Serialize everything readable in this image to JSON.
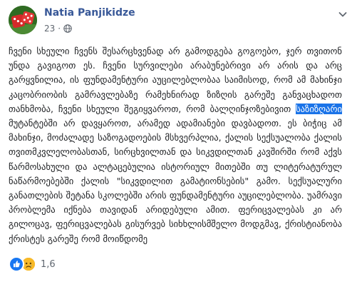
{
  "post": {
    "author": "Natia Panjikidze",
    "timestamp": "23",
    "separator": "·",
    "privacy_icon": "globe-icon",
    "menu_icon": "chevron-down-icon",
    "text_before": "ჩვენი სხეული ჩვენს შესარცხვენად არ გამოდგება გოგოებო, ჯერ თვითონ უნდა გავიგოთ ეს. ჩვენი სურვილები არაბუნებრივი არ არის და არც გარყვნილია, ის ფუნდამენტური აუცილებლობაა საიმისოდ, რომ ამ მახინჯი კაცობრიობის გამრავლებაზე რამეხნირად ზიზღის გარეშე განვაცხადოთ თანხმობა, ჩვენი სხეული შეგიყვაროთ, რომ ბალღინჯოზებივით ",
    "highlighted_text": "საზიზღარი",
    "text_after": " მუტანტებში არ დავყაროთ, არამედ ადამიანები დავბადოთ. ეს ბიჭიც ამ მახინჯი, მოძალადე საზოგადოების მსხვერპლია, ქალის სექსუალობა ქალის თვითმკვლელობასთან, სირცხვილთან და სიკვდილთან კავშირში რომ აქვს წარმოსახული და ალტაცებულია ისტორიულ მითებში თუ ლიტერატურულ ნაწარმოებებში ქალის \"სიკვდილით გამატიონსების\" გამო. სექსუალური განათლების შეტანა სკოლებში არის ფუნდამენტური აუცილებლობა. უამრავი პრობლემა იქნება თავიდან არიდებული ამით. ფერიცვალებას კი არ გილოცავ, ფერიცვალებას გისურვებ სიხხლისმშელო მოდგმავ, ქრისტიანობა ქრისტეს გარეშე რომ მოიწდომე"
  },
  "reactions": {
    "icons": [
      "like-icon",
      "sad-icon"
    ],
    "count": "1,6"
  },
  "colors": {
    "author_link": "#385898",
    "meta_text": "#606770",
    "body_text": "#1c1e21",
    "highlight_bg": "#1a73e8",
    "like_blue": "#1877f2",
    "sad_yellow": "#f7b928"
  }
}
